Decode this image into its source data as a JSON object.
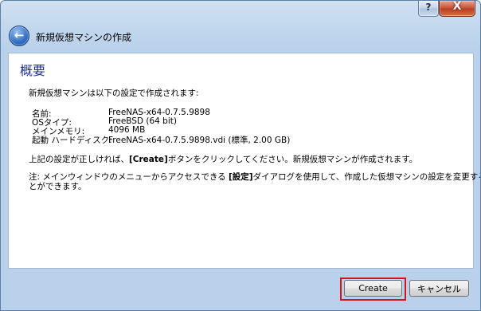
{
  "window": {
    "title_bar": {
      "help_label": "?",
      "close_label": "X"
    },
    "header_title": "新規仮想マシンの作成"
  },
  "summary": {
    "heading": "概要",
    "intro": "新規仮想マシンは以下の設定で作成されます:",
    "settings": [
      {
        "label": "名前:",
        "value": "FreeNAS-x64-0.7.5.9898"
      },
      {
        "label": "OSタイプ:",
        "value": "FreeBSD (64 bit)"
      },
      {
        "label": "メインメモリ:",
        "value": "4096 MB"
      },
      {
        "label": "起動 ハードディスク:",
        "value": "FreeNAS-x64-0.7.5.9898.vdi (標準, 2.00 GB)"
      }
    ],
    "confirm_pre": "上記の設定が正しければ、",
    "confirm_bold": "[Create]",
    "confirm_post": "ボタンをクリックしてください。新規仮想マシンが作成されます。",
    "note_pre": "注: メインウィンドウのメニューからアクセスできる ",
    "note_bold": "[設定]",
    "note_mid": "ダイアログを使用して、作成した仮想マシンの設定を変更するこ",
    "note_line2": "とができます。"
  },
  "buttons": {
    "create": "Create",
    "cancel": "キャンセル"
  },
  "highlight_color": "#d4141c"
}
